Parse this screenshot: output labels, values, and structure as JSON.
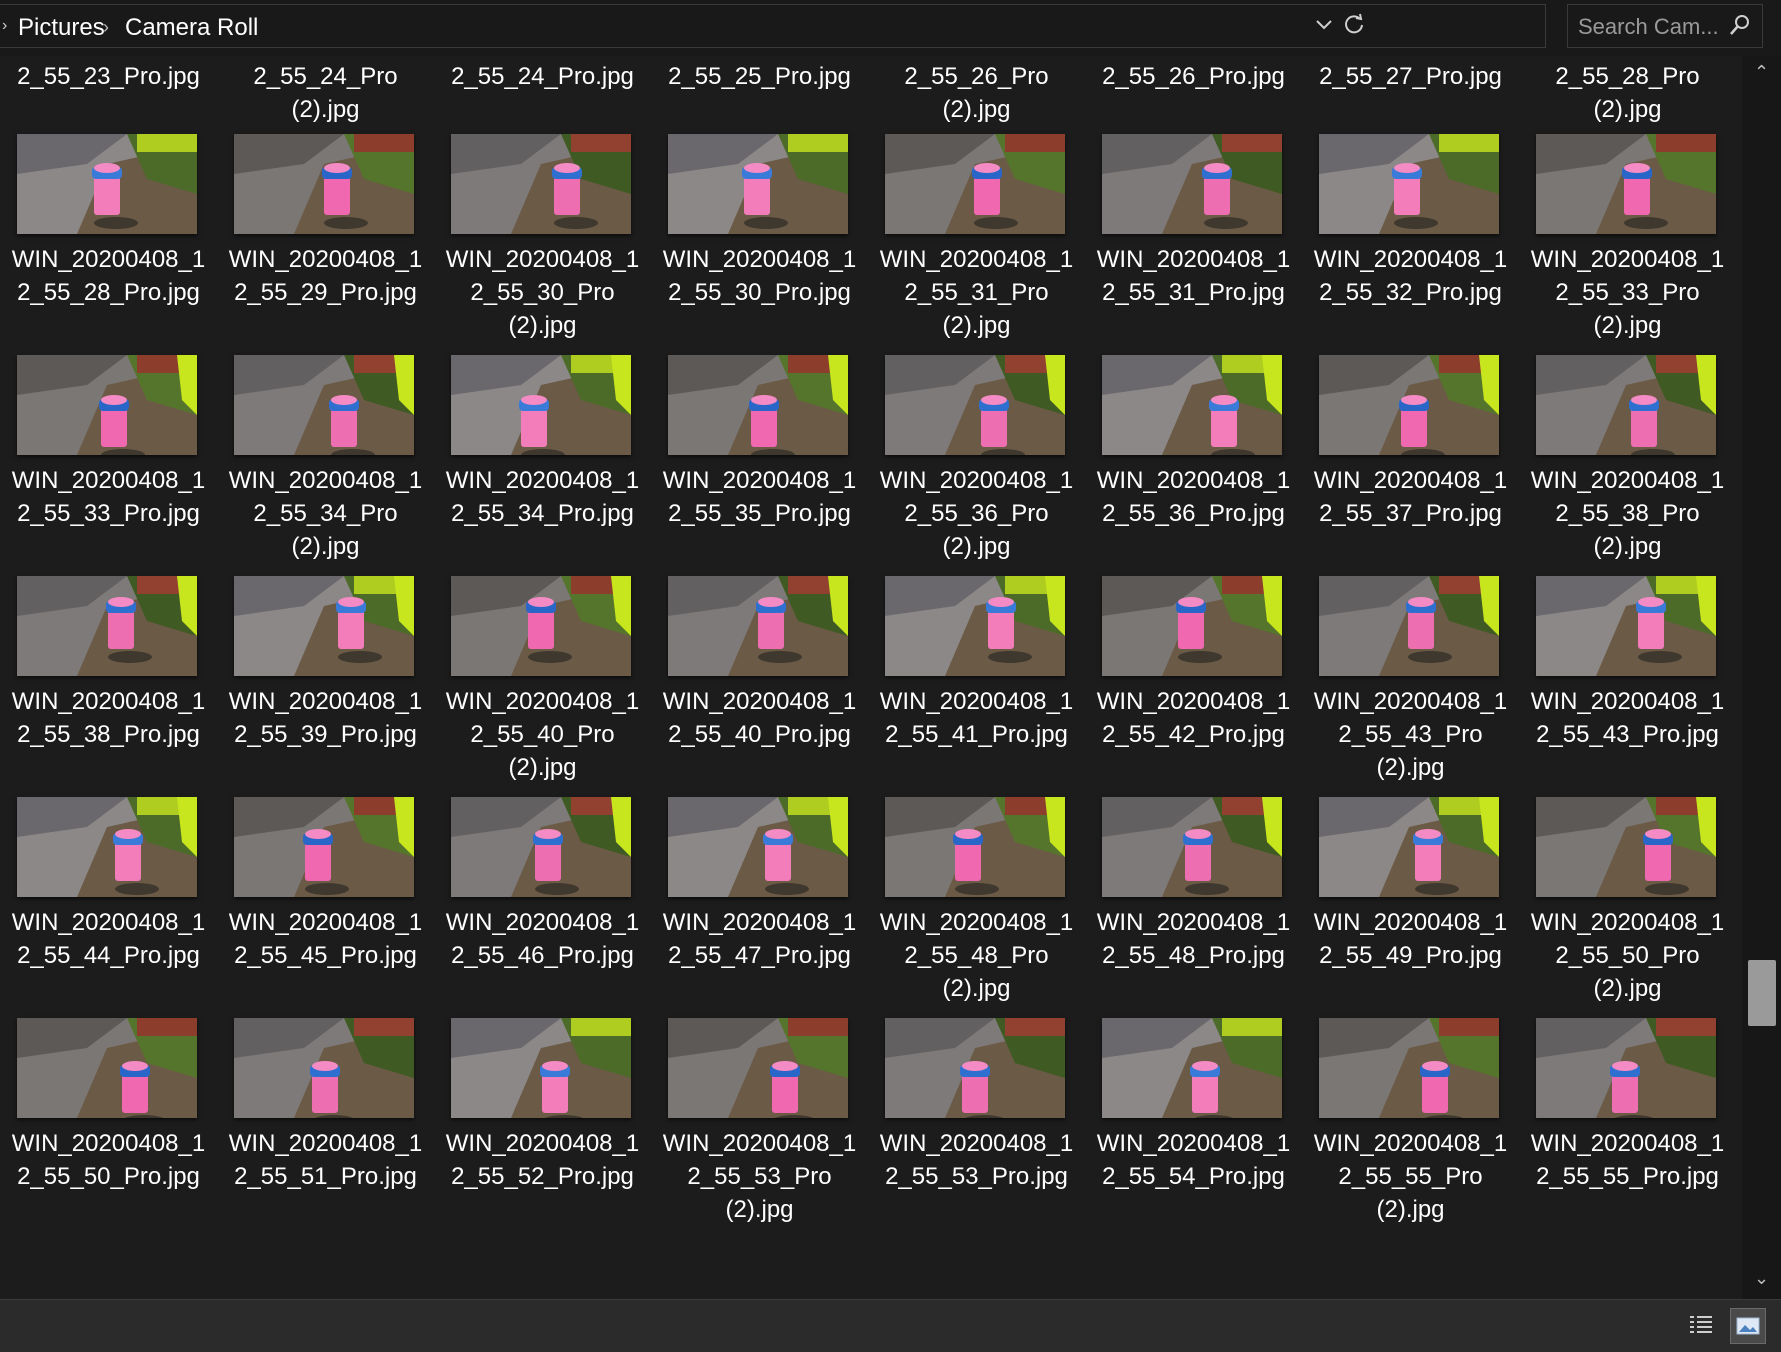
{
  "breadcrumb": {
    "items": [
      "Pictures",
      "Camera Roll"
    ]
  },
  "search": {
    "placeholder": "Search Cam..."
  },
  "files": [
    "2_55_23_Pro.jpg",
    "2_55_24_Pro\n(2).jpg",
    "2_55_24_Pro.jpg",
    "2_55_25_Pro.jpg",
    "2_55_26_Pro\n(2).jpg",
    "2_55_26_Pro.jpg",
    "2_55_27_Pro.jpg",
    "2_55_28_Pro\n(2).jpg",
    "WIN_20200408_1\n2_55_28_Pro.jpg",
    "WIN_20200408_1\n2_55_29_Pro.jpg",
    "WIN_20200408_1\n2_55_30_Pro\n(2).jpg",
    "WIN_20200408_1\n2_55_30_Pro.jpg",
    "WIN_20200408_1\n2_55_31_Pro\n(2).jpg",
    "WIN_20200408_1\n2_55_31_Pro.jpg",
    "WIN_20200408_1\n2_55_32_Pro.jpg",
    "WIN_20200408_1\n2_55_33_Pro\n(2).jpg",
    "WIN_20200408_1\n2_55_33_Pro.jpg",
    "WIN_20200408_1\n2_55_34_Pro\n(2).jpg",
    "WIN_20200408_1\n2_55_34_Pro.jpg",
    "WIN_20200408_1\n2_55_35_Pro.jpg",
    "WIN_20200408_1\n2_55_36_Pro\n(2).jpg",
    "WIN_20200408_1\n2_55_36_Pro.jpg",
    "WIN_20200408_1\n2_55_37_Pro.jpg",
    "WIN_20200408_1\n2_55_38_Pro\n(2).jpg",
    "WIN_20200408_1\n2_55_38_Pro.jpg",
    "WIN_20200408_1\n2_55_39_Pro.jpg",
    "WIN_20200408_1\n2_55_40_Pro\n(2).jpg",
    "WIN_20200408_1\n2_55_40_Pro.jpg",
    "WIN_20200408_1\n2_55_41_Pro.jpg",
    "WIN_20200408_1\n2_55_42_Pro.jpg",
    "WIN_20200408_1\n2_55_43_Pro\n(2).jpg",
    "WIN_20200408_1\n2_55_43_Pro.jpg",
    "WIN_20200408_1\n2_55_44_Pro.jpg",
    "WIN_20200408_1\n2_55_45_Pro.jpg",
    "WIN_20200408_1\n2_55_46_Pro.jpg",
    "WIN_20200408_1\n2_55_47_Pro.jpg",
    "WIN_20200408_1\n2_55_48_Pro\n(2).jpg",
    "WIN_20200408_1\n2_55_48_Pro.jpg",
    "WIN_20200408_1\n2_55_49_Pro.jpg",
    "WIN_20200408_1\n2_55_50_Pro\n(2).jpg",
    "WIN_20200408_1\n2_55_50_Pro.jpg",
    "WIN_20200408_1\n2_55_51_Pro.jpg",
    "WIN_20200408_1\n2_55_52_Pro.jpg",
    "WIN_20200408_1\n2_55_53_Pro\n(2).jpg",
    "WIN_20200408_1\n2_55_53_Pro.jpg",
    "WIN_20200408_1\n2_55_54_Pro.jpg",
    "WIN_20200408_1\n2_55_55_Pro\n(2).jpg",
    "WIN_20200408_1\n2_55_55_Pro.jpg"
  ],
  "icons": {
    "breadcrumb_separator": "chevron-right-icon",
    "dropdown": "chevron-down-icon",
    "refresh": "refresh-icon",
    "search": "search-icon",
    "details_view": "details-view-icon",
    "thumbnail_view": "large-icons-view-icon"
  },
  "colors": {
    "background": "#1c1c1c",
    "statusbar": "#2b2b2b",
    "text": "#ffffff",
    "bin_pink": "#f06aa8",
    "bag_blue": "#2f6fd0",
    "grass": "#4e6b2a",
    "bench_yellow": "#c8e61e"
  }
}
